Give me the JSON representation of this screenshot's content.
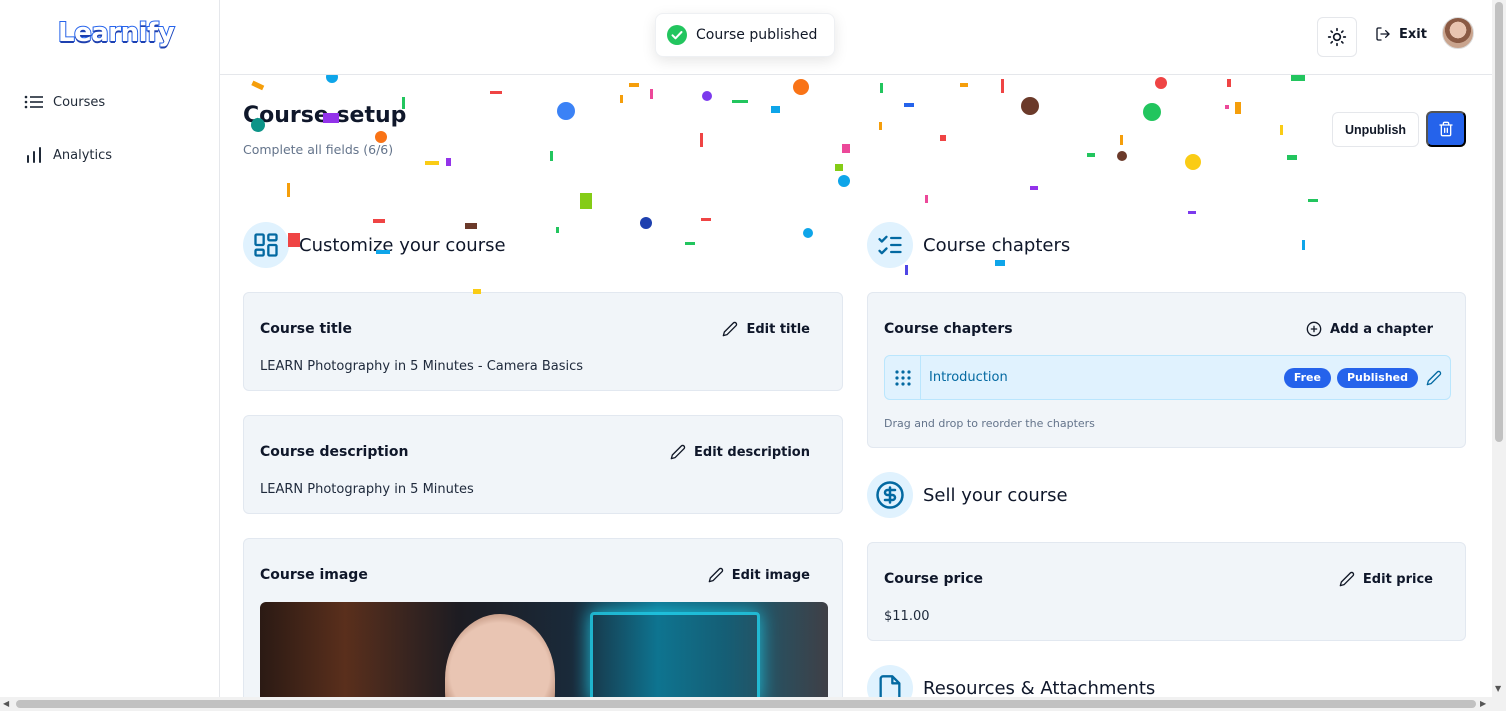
{
  "app": {
    "logo": "Learnify"
  },
  "sidebar": {
    "items": [
      {
        "label": "Courses",
        "icon": "list-icon"
      },
      {
        "label": "Analytics",
        "icon": "bar-chart-icon"
      }
    ]
  },
  "topbar": {
    "exit_label": "Exit",
    "theme_icon": "sun-icon"
  },
  "toast": {
    "message": "Course published",
    "icon": "check-circle-icon",
    "color": "#22c55e"
  },
  "page": {
    "title": "Course setup",
    "subtitle": "Complete all fields (6/6)",
    "unpublish_label": "Unpublish"
  },
  "customize": {
    "heading": "Customize your course",
    "title_card": {
      "label": "Course title",
      "action": "Edit title",
      "value": "LEARN Photography in 5 Minutes - Camera Basics"
    },
    "description_card": {
      "label": "Course description",
      "action": "Edit description",
      "value": "LEARN Photography in 5 Minutes"
    },
    "image_card": {
      "label": "Course image",
      "action": "Edit image"
    }
  },
  "chapters": {
    "heading": "Course chapters",
    "card_label": "Course chapters",
    "action": "Add a chapter",
    "items": [
      {
        "name": "Introduction",
        "badges": [
          "Free",
          "Published"
        ]
      }
    ],
    "hint": "Drag and drop to reorder the chapters"
  },
  "sell": {
    "heading": "Sell your course",
    "price_card": {
      "label": "Course price",
      "action": "Edit price",
      "value": "$11.00"
    }
  },
  "resources": {
    "heading": "Resources & Attachments"
  },
  "colors": {
    "accent": "#2563eb",
    "icon_bg": "#e0f2fe",
    "card_bg": "#f1f5f9"
  }
}
